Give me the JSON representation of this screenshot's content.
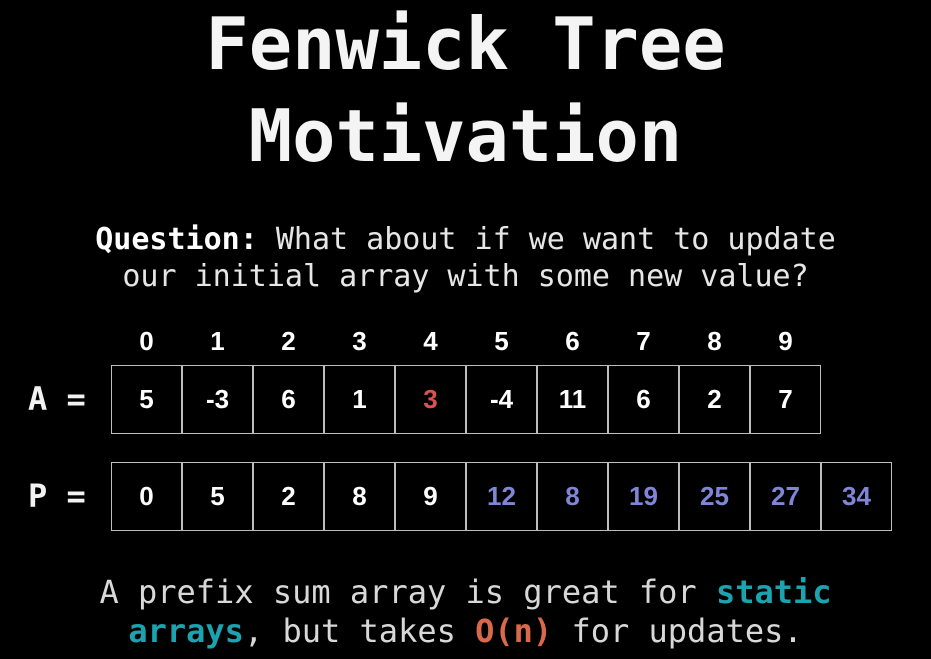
{
  "title": {
    "line1": "Fenwick Tree",
    "line2": "Motivation"
  },
  "question": {
    "label": "Question:",
    "line1_rest": " What about if we want to update",
    "line2": "our initial array with some new value?"
  },
  "indices": [
    "0",
    "1",
    "2",
    "3",
    "4",
    "5",
    "6",
    "7",
    "8",
    "9"
  ],
  "array_a": {
    "label": "A =",
    "values": [
      "5",
      "-3",
      "6",
      "1",
      "3",
      "-4",
      "11",
      "6",
      "2",
      "7"
    ],
    "highlight_index": 4,
    "highlight_color": "#d9534f"
  },
  "array_p": {
    "label": "P =",
    "values": [
      "0",
      "5",
      "2",
      "8",
      "9",
      "12",
      "8",
      "19",
      "25",
      "27",
      "34"
    ],
    "highlight_from_index": 5,
    "highlight_color": "#7f86d8"
  },
  "footer": {
    "line1_text": "A prefix sum array is great for ",
    "line1_emph": "static",
    "line2_emph": "arrays",
    "line2_mid": ", but takes ",
    "line2_big_o": "O(n)",
    "line2_end": " for updates."
  },
  "colors": {
    "background": "#000000",
    "teal": "#1ba3b0",
    "orange": "#d9694a",
    "cell_border": "#bdbdbd"
  }
}
